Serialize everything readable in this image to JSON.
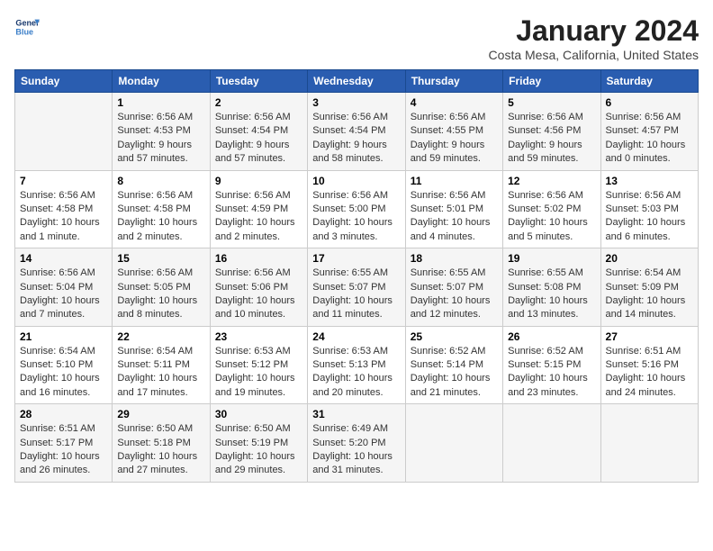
{
  "header": {
    "logo_line1": "General",
    "logo_line2": "Blue",
    "month": "January 2024",
    "location": "Costa Mesa, California, United States"
  },
  "weekdays": [
    "Sunday",
    "Monday",
    "Tuesday",
    "Wednesday",
    "Thursday",
    "Friday",
    "Saturday"
  ],
  "weeks": [
    [
      {
        "day": "",
        "info": ""
      },
      {
        "day": "1",
        "info": "Sunrise: 6:56 AM\nSunset: 4:53 PM\nDaylight: 9 hours\nand 57 minutes."
      },
      {
        "day": "2",
        "info": "Sunrise: 6:56 AM\nSunset: 4:54 PM\nDaylight: 9 hours\nand 57 minutes."
      },
      {
        "day": "3",
        "info": "Sunrise: 6:56 AM\nSunset: 4:54 PM\nDaylight: 9 hours\nand 58 minutes."
      },
      {
        "day": "4",
        "info": "Sunrise: 6:56 AM\nSunset: 4:55 PM\nDaylight: 9 hours\nand 59 minutes."
      },
      {
        "day": "5",
        "info": "Sunrise: 6:56 AM\nSunset: 4:56 PM\nDaylight: 9 hours\nand 59 minutes."
      },
      {
        "day": "6",
        "info": "Sunrise: 6:56 AM\nSunset: 4:57 PM\nDaylight: 10 hours\nand 0 minutes."
      }
    ],
    [
      {
        "day": "7",
        "info": "Sunrise: 6:56 AM\nSunset: 4:58 PM\nDaylight: 10 hours\nand 1 minute."
      },
      {
        "day": "8",
        "info": "Sunrise: 6:56 AM\nSunset: 4:58 PM\nDaylight: 10 hours\nand 2 minutes."
      },
      {
        "day": "9",
        "info": "Sunrise: 6:56 AM\nSunset: 4:59 PM\nDaylight: 10 hours\nand 2 minutes."
      },
      {
        "day": "10",
        "info": "Sunrise: 6:56 AM\nSunset: 5:00 PM\nDaylight: 10 hours\nand 3 minutes."
      },
      {
        "day": "11",
        "info": "Sunrise: 6:56 AM\nSunset: 5:01 PM\nDaylight: 10 hours\nand 4 minutes."
      },
      {
        "day": "12",
        "info": "Sunrise: 6:56 AM\nSunset: 5:02 PM\nDaylight: 10 hours\nand 5 minutes."
      },
      {
        "day": "13",
        "info": "Sunrise: 6:56 AM\nSunset: 5:03 PM\nDaylight: 10 hours\nand 6 minutes."
      }
    ],
    [
      {
        "day": "14",
        "info": "Sunrise: 6:56 AM\nSunset: 5:04 PM\nDaylight: 10 hours\nand 7 minutes."
      },
      {
        "day": "15",
        "info": "Sunrise: 6:56 AM\nSunset: 5:05 PM\nDaylight: 10 hours\nand 8 minutes."
      },
      {
        "day": "16",
        "info": "Sunrise: 6:56 AM\nSunset: 5:06 PM\nDaylight: 10 hours\nand 10 minutes."
      },
      {
        "day": "17",
        "info": "Sunrise: 6:55 AM\nSunset: 5:07 PM\nDaylight: 10 hours\nand 11 minutes."
      },
      {
        "day": "18",
        "info": "Sunrise: 6:55 AM\nSunset: 5:07 PM\nDaylight: 10 hours\nand 12 minutes."
      },
      {
        "day": "19",
        "info": "Sunrise: 6:55 AM\nSunset: 5:08 PM\nDaylight: 10 hours\nand 13 minutes."
      },
      {
        "day": "20",
        "info": "Sunrise: 6:54 AM\nSunset: 5:09 PM\nDaylight: 10 hours\nand 14 minutes."
      }
    ],
    [
      {
        "day": "21",
        "info": "Sunrise: 6:54 AM\nSunset: 5:10 PM\nDaylight: 10 hours\nand 16 minutes."
      },
      {
        "day": "22",
        "info": "Sunrise: 6:54 AM\nSunset: 5:11 PM\nDaylight: 10 hours\nand 17 minutes."
      },
      {
        "day": "23",
        "info": "Sunrise: 6:53 AM\nSunset: 5:12 PM\nDaylight: 10 hours\nand 19 minutes."
      },
      {
        "day": "24",
        "info": "Sunrise: 6:53 AM\nSunset: 5:13 PM\nDaylight: 10 hours\nand 20 minutes."
      },
      {
        "day": "25",
        "info": "Sunrise: 6:52 AM\nSunset: 5:14 PM\nDaylight: 10 hours\nand 21 minutes."
      },
      {
        "day": "26",
        "info": "Sunrise: 6:52 AM\nSunset: 5:15 PM\nDaylight: 10 hours\nand 23 minutes."
      },
      {
        "day": "27",
        "info": "Sunrise: 6:51 AM\nSunset: 5:16 PM\nDaylight: 10 hours\nand 24 minutes."
      }
    ],
    [
      {
        "day": "28",
        "info": "Sunrise: 6:51 AM\nSunset: 5:17 PM\nDaylight: 10 hours\nand 26 minutes."
      },
      {
        "day": "29",
        "info": "Sunrise: 6:50 AM\nSunset: 5:18 PM\nDaylight: 10 hours\nand 27 minutes."
      },
      {
        "day": "30",
        "info": "Sunrise: 6:50 AM\nSunset: 5:19 PM\nDaylight: 10 hours\nand 29 minutes."
      },
      {
        "day": "31",
        "info": "Sunrise: 6:49 AM\nSunset: 5:20 PM\nDaylight: 10 hours\nand 31 minutes."
      },
      {
        "day": "",
        "info": ""
      },
      {
        "day": "",
        "info": ""
      },
      {
        "day": "",
        "info": ""
      }
    ]
  ]
}
